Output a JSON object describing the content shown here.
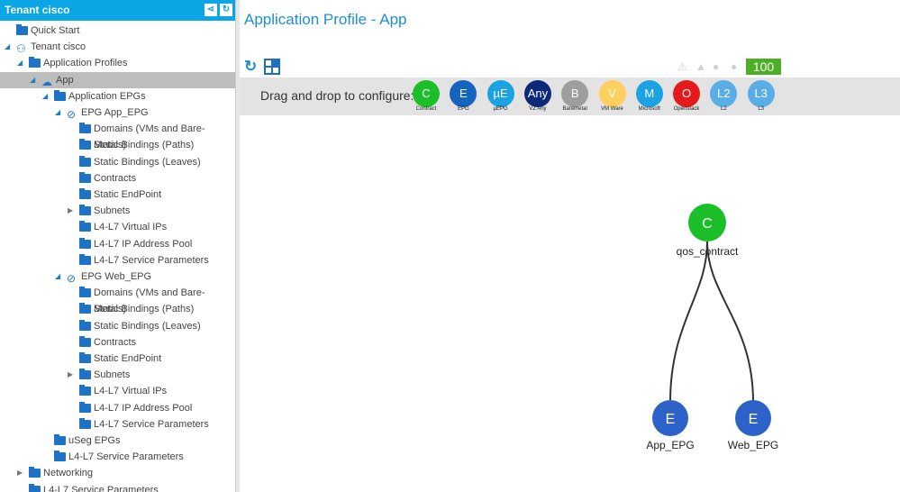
{
  "sidebar": {
    "title": "Tenant cisco",
    "items": [
      {
        "label": "Quick Start",
        "icon": "folder-icon",
        "arrow": ""
      },
      {
        "label": "Tenant cisco",
        "icon": "tenant-icon",
        "arrow": "open"
      },
      {
        "label": "Application Profiles",
        "icon": "folder-icon",
        "arrow": "open"
      },
      {
        "label": "App",
        "icon": "app-profile-icon",
        "arrow": "open",
        "selected": true
      },
      {
        "label": "Application EPGs",
        "icon": "folder-icon",
        "arrow": "open"
      },
      {
        "label": "EPG App_EPG",
        "icon": "epg-icon",
        "arrow": "open"
      },
      {
        "label": "Domains (VMs and Bare-Metals)",
        "icon": "folder-icon",
        "arrow": ""
      },
      {
        "label": "Static Bindings (Paths)",
        "icon": "folder-icon",
        "arrow": ""
      },
      {
        "label": "Static Bindings (Leaves)",
        "icon": "folder-icon",
        "arrow": ""
      },
      {
        "label": "Contracts",
        "icon": "folder-icon",
        "arrow": ""
      },
      {
        "label": "Static EndPoint",
        "icon": "folder-icon",
        "arrow": ""
      },
      {
        "label": "Subnets",
        "icon": "folder-icon",
        "arrow": "closed"
      },
      {
        "label": "L4-L7 Virtual IPs",
        "icon": "folder-icon",
        "arrow": ""
      },
      {
        "label": "L4-L7 IP Address Pool",
        "icon": "folder-icon",
        "arrow": ""
      },
      {
        "label": "L4-L7 Service Parameters",
        "icon": "folder-icon",
        "arrow": ""
      },
      {
        "label": "EPG Web_EPG",
        "icon": "epg-icon",
        "arrow": "open"
      },
      {
        "label": "Domains (VMs and Bare-Metals)",
        "icon": "folder-icon",
        "arrow": ""
      },
      {
        "label": "Static Bindings (Paths)",
        "icon": "folder-icon",
        "arrow": ""
      },
      {
        "label": "Static Bindings (Leaves)",
        "icon": "folder-icon",
        "arrow": ""
      },
      {
        "label": "Contracts",
        "icon": "folder-icon",
        "arrow": ""
      },
      {
        "label": "Static EndPoint",
        "icon": "folder-icon",
        "arrow": ""
      },
      {
        "label": "Subnets",
        "icon": "folder-icon",
        "arrow": "closed"
      },
      {
        "label": "L4-L7 Virtual IPs",
        "icon": "folder-icon",
        "arrow": ""
      },
      {
        "label": "L4-L7 IP Address Pool",
        "icon": "folder-icon",
        "arrow": ""
      },
      {
        "label": "L4-L7 Service Parameters",
        "icon": "folder-icon",
        "arrow": ""
      },
      {
        "label": "uSeg EPGs",
        "icon": "folder-icon",
        "arrow": ""
      },
      {
        "label": "L4-L7 Service Parameters",
        "icon": "folder-icon",
        "arrow": ""
      },
      {
        "label": "Networking",
        "icon": "folder-icon",
        "arrow": "closed"
      },
      {
        "label": "L4-L7 Service Parameters",
        "icon": "folder-icon",
        "arrow": ""
      }
    ]
  },
  "header": {
    "title": "Application Profile - App"
  },
  "toolbar": {
    "health_score": "100"
  },
  "palette": {
    "label": "Drag and drop to configure:",
    "items": [
      {
        "letter": "C",
        "caption": "Contract",
        "color": "#1bbf2a"
      },
      {
        "letter": "E",
        "caption": "EPG",
        "color": "#1565c0"
      },
      {
        "letter": "µE",
        "caption": "µEPG",
        "color": "#1aa3e0"
      },
      {
        "letter": "Any",
        "caption": "VZ Any",
        "color": "#0d2a7a"
      },
      {
        "letter": "B",
        "caption": "Baremetal",
        "color": "#9e9e9e"
      },
      {
        "letter": "V",
        "caption": "VM Ware",
        "color": "#ffd060"
      },
      {
        "letter": "M",
        "caption": "Microsoft",
        "color": "#1aa3e0"
      },
      {
        "letter": "O",
        "caption": "Openstack",
        "color": "#e51a1a"
      },
      {
        "letter": "L2",
        "caption": "L2",
        "color": "#5aaee8"
      },
      {
        "letter": "L3",
        "caption": "L3",
        "color": "#5aaee8"
      }
    ]
  },
  "graph": {
    "contract": {
      "letter": "C",
      "label": "qos_contract",
      "color": "#1bbf2a"
    },
    "epgs": [
      {
        "letter": "E",
        "label": "App_EPG",
        "color": "#2d62c8"
      },
      {
        "letter": "E",
        "label": "Web_EPG",
        "color": "#2d62c8"
      }
    ]
  }
}
